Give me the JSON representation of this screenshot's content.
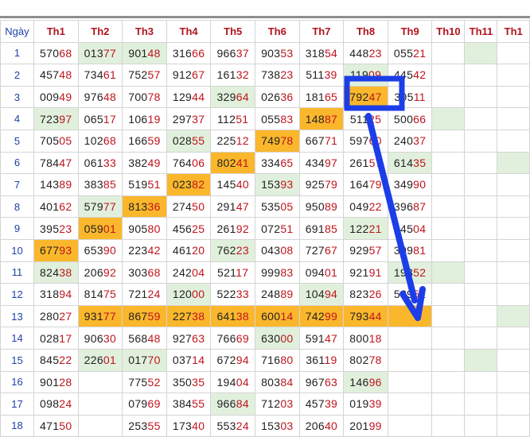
{
  "header": {
    "day_label": "Ngày",
    "columns": [
      "Th1",
      "Th2",
      "Th3",
      "Th4",
      "Th5",
      "Th6",
      "Th7",
      "Th8",
      "Th9",
      "Th10",
      "Th11",
      "Th1"
    ]
  },
  "colors": {
    "green_highlight": "#e1f0dc",
    "orange_highlight": "#fbb72c",
    "annotation_blue": "#1c3ee8",
    "tail_digits": "#c0141e"
  },
  "rows": [
    {
      "day": "1",
      "cells": [
        "57068",
        "01377",
        "90148",
        "31666",
        "96637",
        "90353",
        "31854",
        "44823",
        "05521",
        "",
        "",
        ""
      ]
    },
    {
      "day": "2",
      "cells": [
        "45748",
        "73461",
        "75257",
        "91267",
        "16132",
        "73823",
        "51139",
        "11909",
        "44542",
        "",
        "",
        ""
      ]
    },
    {
      "day": "3",
      "cells": [
        "00949",
        "97648",
        "70078",
        "12944",
        "32964",
        "02636",
        "18165",
        "79247",
        "39511",
        "",
        "",
        ""
      ]
    },
    {
      "day": "4",
      "cells": [
        "72397",
        "06517",
        "10619",
        "29737",
        "11251",
        "05583",
        "14887",
        "51125",
        "50066",
        "",
        "",
        ""
      ]
    },
    {
      "day": "5",
      "cells": [
        "70505",
        "10268",
        "16659",
        "02855",
        "22512",
        "74978",
        "66771",
        "59760",
        "24037",
        "",
        "",
        ""
      ]
    },
    {
      "day": "6",
      "cells": [
        "78447",
        "06133",
        "38249",
        "76406",
        "80241",
        "33465",
        "43497",
        "26157",
        "61435",
        "",
        "",
        ""
      ]
    },
    {
      "day": "7",
      "cells": [
        "14389",
        "38385",
        "51951",
        "02382",
        "14540",
        "15393",
        "92579",
        "16479",
        "34990",
        "",
        "",
        ""
      ]
    },
    {
      "day": "8",
      "cells": [
        "40162",
        "57977",
        "81336",
        "27450",
        "29147",
        "53505",
        "95089",
        "04922",
        "39687",
        "",
        "",
        ""
      ]
    },
    {
      "day": "9",
      "cells": [
        "39523",
        "05901",
        "90580",
        "45625",
        "26192",
        "07251",
        "69185",
        "12221",
        "94504",
        "",
        "",
        ""
      ]
    },
    {
      "day": "10",
      "cells": [
        "67793",
        "65390",
        "22342",
        "46120",
        "76223",
        "04308",
        "72767",
        "92957",
        "30981",
        "",
        "",
        ""
      ]
    },
    {
      "day": "11",
      "cells": [
        "82438",
        "20692",
        "30368",
        "24204",
        "52117",
        "99983",
        "09401",
        "92191",
        "19352",
        "",
        "",
        ""
      ]
    },
    {
      "day": "12",
      "cells": [
        "31894",
        "81475",
        "72124",
        "12000",
        "52233",
        "24889",
        "10494",
        "82326",
        "58951",
        "",
        "",
        ""
      ]
    },
    {
      "day": "13",
      "cells": [
        "28027",
        "93177",
        "86759",
        "22738",
        "64138",
        "60014",
        "74299",
        "79344",
        "",
        "",
        "",
        ""
      ]
    },
    {
      "day": "14",
      "cells": [
        "02817",
        "90630",
        "56848",
        "92763",
        "76669",
        "63000",
        "59147",
        "80018",
        "",
        "",
        "",
        ""
      ]
    },
    {
      "day": "15",
      "cells": [
        "84522",
        "22601",
        "01770",
        "03714",
        "67294",
        "71680",
        "36119",
        "80278",
        "",
        "",
        "",
        ""
      ]
    },
    {
      "day": "16",
      "cells": [
        "90128",
        "",
        "77552",
        "35035",
        "19404",
        "80384",
        "96763",
        "14696",
        "",
        "",
        "",
        ""
      ]
    },
    {
      "day": "17",
      "cells": [
        "09824",
        "",
        "07969",
        "38455",
        "96684",
        "71203",
        "45739",
        "01939",
        "",
        "",
        "",
        ""
      ]
    },
    {
      "day": "18",
      "cells": [
        "47150",
        "",
        "25355",
        "17340",
        "55324",
        "15303",
        "20640",
        "20199",
        "",
        "",
        "",
        ""
      ]
    }
  ]
}
